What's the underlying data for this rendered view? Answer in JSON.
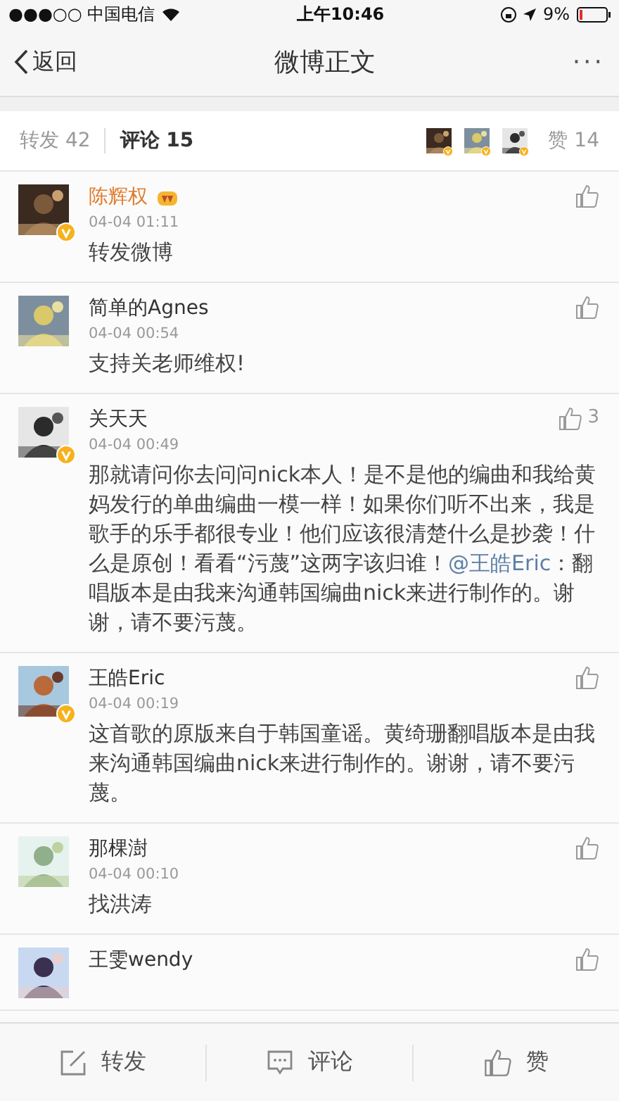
{
  "status_bar": {
    "carrier": "●●●○○ 中国电信",
    "time": "上午10:46",
    "battery": "9%"
  },
  "nav": {
    "back": "返回",
    "title": "微博正文",
    "more": "···"
  },
  "tabs": [
    {
      "label": "转发 42",
      "selected": false
    },
    {
      "label": "评论 15",
      "selected": true
    }
  ],
  "likes_summary": {
    "label": "赞 14",
    "avatars": [
      {
        "kind": "picture",
        "verified": true
      },
      {
        "kind": "picture",
        "verified": true
      },
      {
        "kind": "picture",
        "verified": true
      }
    ]
  },
  "comments": [
    {
      "name": "陈辉权",
      "vip": true,
      "verified": true,
      "time": "04-04 01:11",
      "body": [
        {
          "kind": "text",
          "text": "转发微博"
        }
      ]
    },
    {
      "name": "简单的Agnes",
      "vip": false,
      "verified": false,
      "time": "04-04 00:54",
      "body": [
        {
          "kind": "text",
          "text": "支持关老师维权!"
        }
      ]
    },
    {
      "name": "关天天",
      "vip": false,
      "verified": true,
      "time": "04-04 00:49",
      "likes": "3",
      "body": [
        {
          "kind": "text",
          "text": "那就请问你去问问nick本人！是不是他的编曲和我给黄妈发行的单曲编曲一模一样！如果你们听不出来，我是歌手的乐手都很专业！他们应该很清楚什么是抄袭！什么是原创！看看“污蔑”这两字该归谁！"
        },
        {
          "kind": "mention",
          "text": "@王皓Eric"
        },
        {
          "kind": "text",
          "text": "：翻唱版本是由我来沟通韩国编曲nick来进行制作的。谢谢，请不要污蔑。"
        }
      ]
    },
    {
      "name": "王皓Eric",
      "vip": false,
      "verified": true,
      "time": "04-04 00:19",
      "body": [
        {
          "kind": "text",
          "text": "这首歌的原版来自于韩国童谣。黄绮珊翻唱版本是由我来沟通韩国编曲nick来进行制作的。谢谢，请不要污蔑。"
        }
      ]
    },
    {
      "name": "那棵澍",
      "vip": false,
      "verified": false,
      "time": "04-04 00:10",
      "body": [
        {
          "kind": "text",
          "text": "找洪涛"
        }
      ]
    },
    {
      "name": "王雯wendy",
      "vip": false,
      "verified": false
    }
  ],
  "toolbar": [
    {
      "kind": "repost",
      "label": "转发"
    },
    {
      "kind": "comment",
      "label": "评论"
    },
    {
      "kind": "like",
      "label": "赞"
    }
  ]
}
